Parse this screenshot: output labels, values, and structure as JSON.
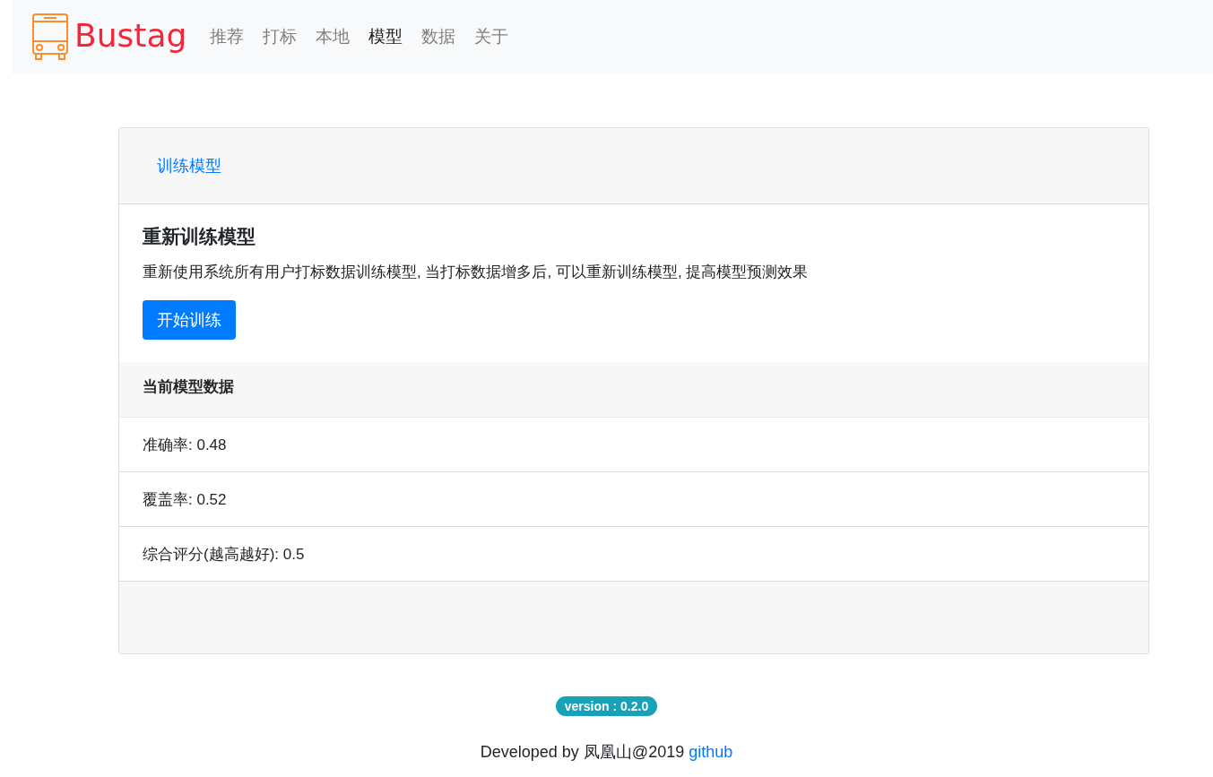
{
  "brand": "Bustag",
  "nav": [
    {
      "label": "推荐",
      "selected": false
    },
    {
      "label": "打标",
      "selected": false
    },
    {
      "label": "本地",
      "selected": false
    },
    {
      "label": "模型",
      "selected": true
    },
    {
      "label": "数据",
      "selected": false
    },
    {
      "label": "关于",
      "selected": false
    }
  ],
  "card": {
    "header_link": "训练模型",
    "title": "重新训练模型",
    "description": "重新使用系统所有用户打标数据训练模型, 当打标数据增多后, 可以重新训练模型, 提高模型预测效果",
    "button": "开始训练",
    "stats_heading": "当前模型数据",
    "stats": [
      "准确率: 0.48",
      "覆盖率: 0.52",
      "综合评分(越高越好): 0.5"
    ]
  },
  "footer": {
    "version": "version : 0.2.0",
    "credit": "Developed by 凤凰山@2019",
    "link": "github"
  }
}
